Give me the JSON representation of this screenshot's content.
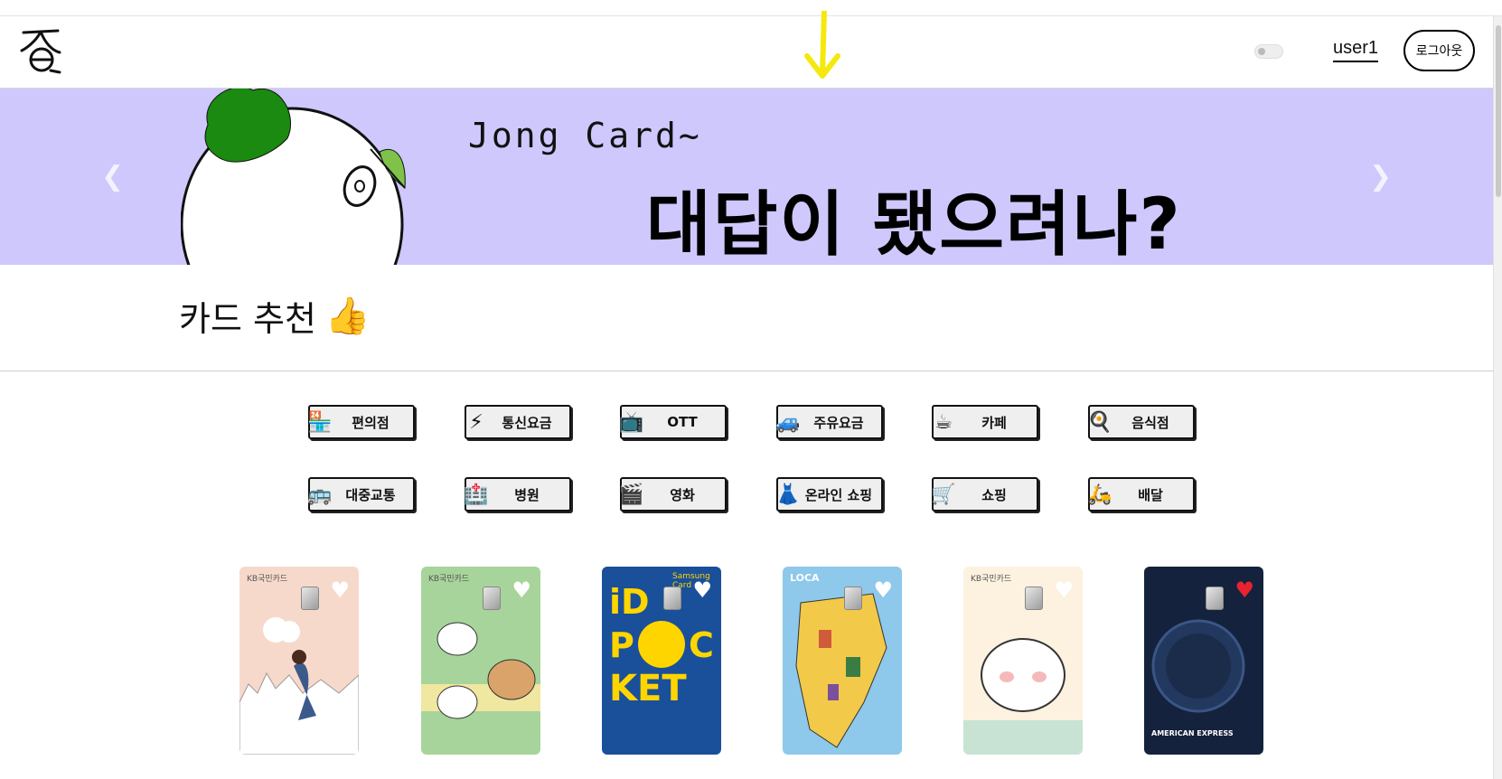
{
  "header": {
    "user": "user1",
    "logout_label": "로그아웃"
  },
  "banner": {
    "subtitle": "Jong Card~",
    "headline": "대답이 됐으려나?",
    "background": "#cec8fd"
  },
  "section": {
    "title": "카드 추천",
    "title_icon": "thumbs-up-icon"
  },
  "categories": [
    {
      "label": "편의점",
      "icon": "convenience-store-icon",
      "glyph": "🏪"
    },
    {
      "label": "통신요금",
      "icon": "lightning-icon",
      "glyph": "⚡"
    },
    {
      "label": "OTT",
      "icon": "tv-icon",
      "glyph": "📺"
    },
    {
      "label": "주유요금",
      "icon": "car-icon",
      "glyph": "🚙"
    },
    {
      "label": "카페",
      "icon": "coffee-icon",
      "glyph": "☕"
    },
    {
      "label": "음식점",
      "icon": "frying-pan-icon",
      "glyph": "🍳"
    },
    {
      "label": "대중교통",
      "icon": "bus-icon",
      "glyph": "🚌"
    },
    {
      "label": "병원",
      "icon": "hospital-icon",
      "glyph": "🏥"
    },
    {
      "label": "영화",
      "icon": "clapper-icon",
      "glyph": "🎬"
    },
    {
      "label": "온라인 쇼핑",
      "icon": "dress-icon",
      "glyph": "👗"
    },
    {
      "label": "쇼핑",
      "icon": "cart-icon",
      "glyph": "🛒"
    },
    {
      "label": "배달",
      "icon": "scooter-icon",
      "glyph": "🛵"
    }
  ],
  "cards": [
    {
      "brand": "KB국민카드",
      "liked": false,
      "bg": "#f7d9cc"
    },
    {
      "brand": "KB국민카드",
      "liked": false,
      "bg": "#a7d49a"
    },
    {
      "brand": "Samsung Card",
      "liked": false,
      "bg": "#1a4f9a"
    },
    {
      "brand": "LOCA",
      "liked": false,
      "bg": "#8ec8ea"
    },
    {
      "brand": "KB국민카드",
      "liked": false,
      "bg": "#fdf1e0"
    },
    {
      "brand": "AMERICAN EXPRESS",
      "liked": true,
      "bg": "#14223d"
    }
  ]
}
